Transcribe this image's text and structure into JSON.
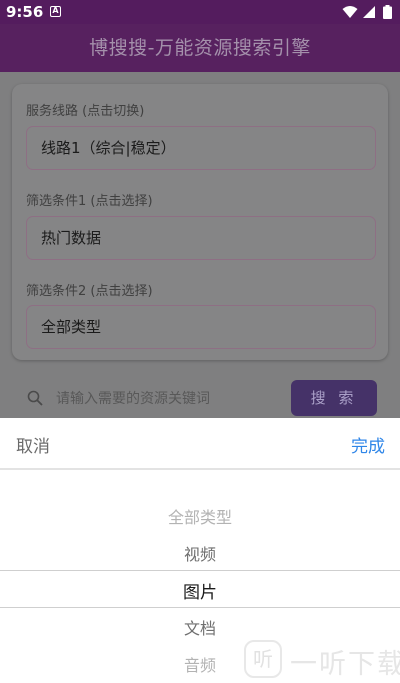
{
  "status_bar": {
    "time": "9:56",
    "notification_icon": "A"
  },
  "app_bar": {
    "title": "博搜搜-万能资源搜索引擎"
  },
  "form": {
    "server_line": {
      "label": "服务线路 (点击切换)",
      "value": "线路1（综合|稳定）"
    },
    "filter1": {
      "label": "筛选条件1 (点击选择)",
      "value": "热门数据"
    },
    "filter2": {
      "label": "筛选条件2 (点击选择)",
      "value": "全部类型"
    }
  },
  "search": {
    "placeholder": "请输入需要的资源关键词",
    "button_label": "搜 索"
  },
  "picker": {
    "cancel_label": "取消",
    "done_label": "完成",
    "options": [
      "全部类型",
      "视频",
      "图片",
      "文档",
      "音频"
    ],
    "selected_index": 2
  },
  "watermark": {
    "icon_glyph": "听",
    "text": "一听下载"
  },
  "colors": {
    "app_bar": "#57215f",
    "search_button": "#453268",
    "done_link": "#2f86e8",
    "overlay": "#7f7f80"
  }
}
